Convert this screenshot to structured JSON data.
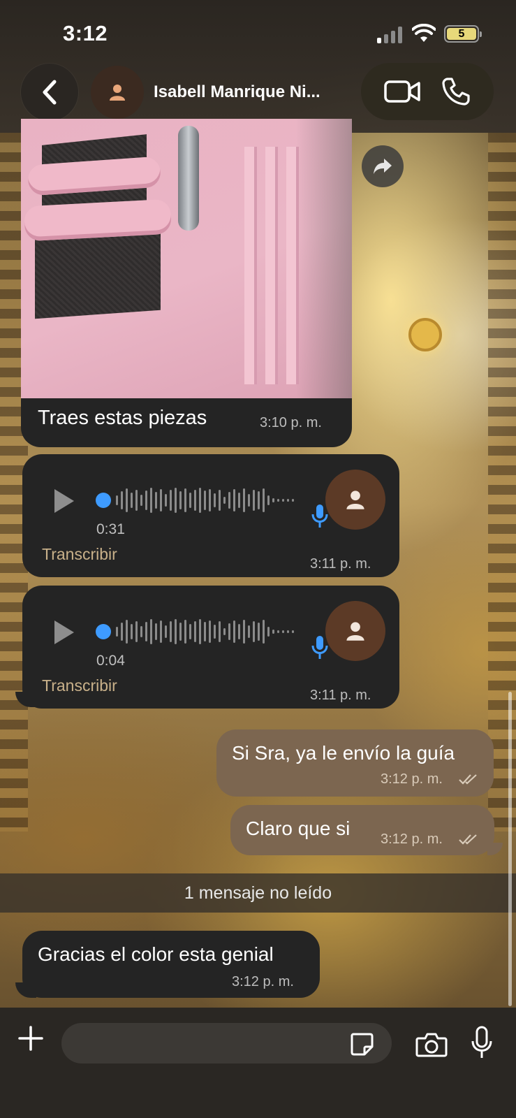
{
  "status_bar": {
    "time": "3:12",
    "battery": "5"
  },
  "header": {
    "contact_name": "Isabell Manrique Ni...",
    "icons": {
      "back": "chevron-left-icon",
      "video": "video-camera-icon",
      "call": "phone-icon",
      "avatar": "person-icon"
    }
  },
  "messages": [
    {
      "type": "image",
      "direction": "incoming",
      "caption": "Traes estas piezas",
      "time": "3:10 p. m."
    },
    {
      "type": "voice",
      "direction": "incoming",
      "duration": "0:31",
      "transcribe_label": "Transcribir",
      "time": "3:11 p. m."
    },
    {
      "type": "voice",
      "direction": "incoming",
      "duration": "0:04",
      "transcribe_label": "Transcribir",
      "time": "3:11 p. m."
    },
    {
      "type": "text",
      "direction": "outgoing",
      "text": "Si Sra, ya le envío la guía",
      "time": "3:12 p. m.",
      "status": "read"
    },
    {
      "type": "text",
      "direction": "outgoing",
      "text": "Claro que si",
      "time": "3:12 p. m.",
      "status": "read"
    },
    {
      "type": "text",
      "direction": "incoming",
      "text": "Gracias el color esta genial",
      "time": "3:12 p. m."
    }
  ],
  "unread_banner": "1 mensaje no leído",
  "composer": {
    "placeholder": "",
    "icons": {
      "attach": "plus-icon",
      "sticker": "sticker-icon",
      "camera": "camera-icon",
      "mic": "microphone-icon"
    }
  },
  "colors": {
    "incoming_bubble": "#242424",
    "outgoing_bubble": "#7c6650",
    "accent_blue": "#3e9bff",
    "transcribe": "#c9b18a"
  }
}
